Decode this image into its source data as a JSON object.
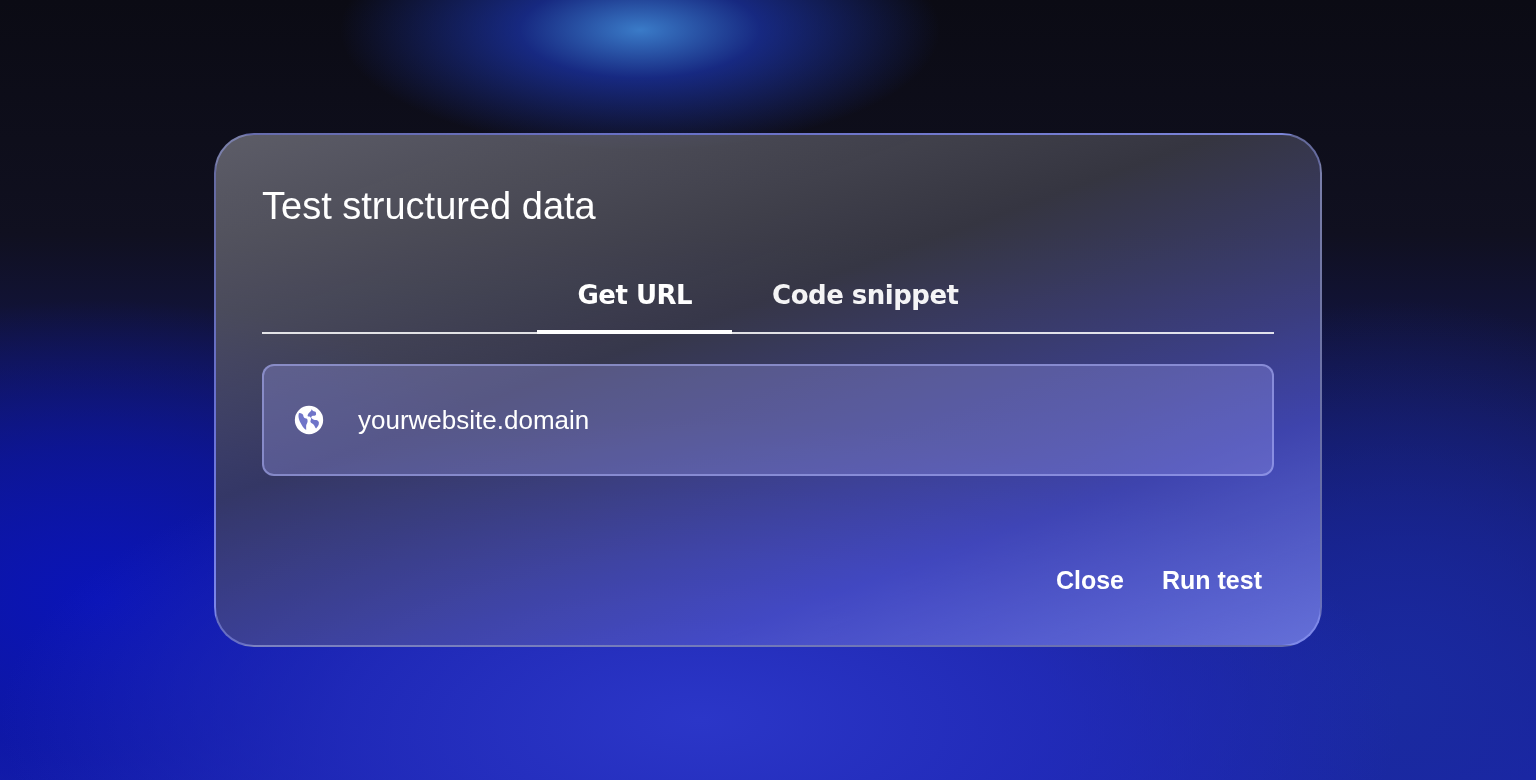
{
  "dialog": {
    "title": "Test structured data",
    "tabs": [
      {
        "label": "Get URL",
        "selected": true
      },
      {
        "label": "Code snippet",
        "selected": false
      }
    ],
    "url_field": {
      "placeholder": "yourwebsite.domain"
    },
    "buttons": [
      {
        "label": "Close"
      },
      {
        "label": "Run test"
      }
    ]
  }
}
